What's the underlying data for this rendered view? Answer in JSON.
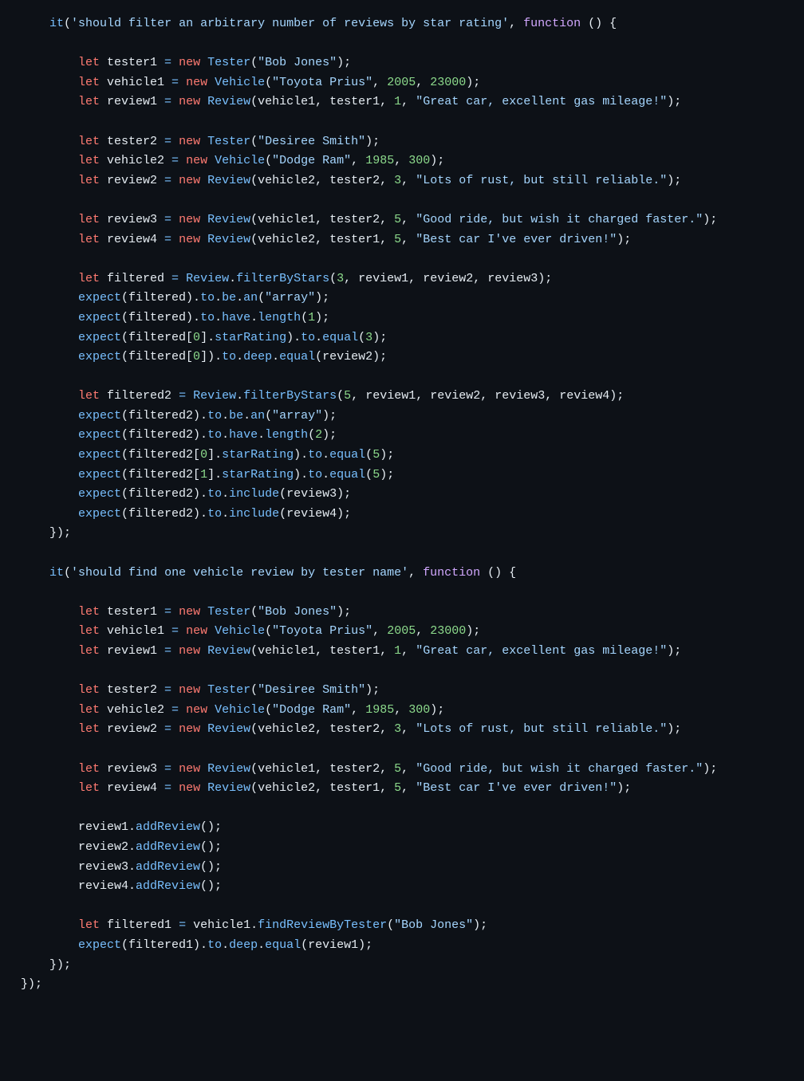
{
  "tokens": [
    [
      [
        "    ",
        "pu"
      ],
      [
        "it",
        "fn"
      ],
      [
        "(",
        "pu"
      ],
      [
        "'should filter an arbitrary number of reviews by star rating'",
        "st"
      ],
      [
        ", ",
        "pu"
      ],
      [
        "function",
        "fk"
      ],
      [
        " () {",
        "pu"
      ]
    ],
    [],
    [
      [
        "        ",
        "pu"
      ],
      [
        "let",
        "kw"
      ],
      [
        " tester1 ",
        "id"
      ],
      [
        "=",
        "op"
      ],
      [
        " ",
        "pu"
      ],
      [
        "new",
        "kw"
      ],
      [
        " ",
        "pu"
      ],
      [
        "Tester",
        "fn"
      ],
      [
        "(",
        "pu"
      ],
      [
        "\"Bob Jones\"",
        "st"
      ],
      [
        ");",
        "pu"
      ]
    ],
    [
      [
        "        ",
        "pu"
      ],
      [
        "let",
        "kw"
      ],
      [
        " vehicle1 ",
        "id"
      ],
      [
        "=",
        "op"
      ],
      [
        " ",
        "pu"
      ],
      [
        "new",
        "kw"
      ],
      [
        " ",
        "pu"
      ],
      [
        "Vehicle",
        "fn"
      ],
      [
        "(",
        "pu"
      ],
      [
        "\"Toyota Prius\"",
        "st"
      ],
      [
        ", ",
        "pu"
      ],
      [
        "2005",
        "nu"
      ],
      [
        ", ",
        "pu"
      ],
      [
        "23000",
        "nu"
      ],
      [
        ");",
        "pu"
      ]
    ],
    [
      [
        "        ",
        "pu"
      ],
      [
        "let",
        "kw"
      ],
      [
        " review1 ",
        "id"
      ],
      [
        "=",
        "op"
      ],
      [
        " ",
        "pu"
      ],
      [
        "new",
        "kw"
      ],
      [
        " ",
        "pu"
      ],
      [
        "Review",
        "fn"
      ],
      [
        "(vehicle1, tester1, ",
        "pu"
      ],
      [
        "1",
        "nu"
      ],
      [
        ", ",
        "pu"
      ],
      [
        "\"Great car, excellent gas mileage!\"",
        "st"
      ],
      [
        ");",
        "pu"
      ]
    ],
    [],
    [
      [
        "        ",
        "pu"
      ],
      [
        "let",
        "kw"
      ],
      [
        " tester2 ",
        "id"
      ],
      [
        "=",
        "op"
      ],
      [
        " ",
        "pu"
      ],
      [
        "new",
        "kw"
      ],
      [
        " ",
        "pu"
      ],
      [
        "Tester",
        "fn"
      ],
      [
        "(",
        "pu"
      ],
      [
        "\"Desiree Smith\"",
        "st"
      ],
      [
        ");",
        "pu"
      ]
    ],
    [
      [
        "        ",
        "pu"
      ],
      [
        "let",
        "kw"
      ],
      [
        " vehicle2 ",
        "id"
      ],
      [
        "=",
        "op"
      ],
      [
        " ",
        "pu"
      ],
      [
        "new",
        "kw"
      ],
      [
        " ",
        "pu"
      ],
      [
        "Vehicle",
        "fn"
      ],
      [
        "(",
        "pu"
      ],
      [
        "\"Dodge Ram\"",
        "st"
      ],
      [
        ", ",
        "pu"
      ],
      [
        "1985",
        "nu"
      ],
      [
        ", ",
        "pu"
      ],
      [
        "300",
        "nu"
      ],
      [
        ");",
        "pu"
      ]
    ],
    [
      [
        "        ",
        "pu"
      ],
      [
        "let",
        "kw"
      ],
      [
        " review2 ",
        "id"
      ],
      [
        "=",
        "op"
      ],
      [
        " ",
        "pu"
      ],
      [
        "new",
        "kw"
      ],
      [
        " ",
        "pu"
      ],
      [
        "Review",
        "fn"
      ],
      [
        "(vehicle2, tester2, ",
        "pu"
      ],
      [
        "3",
        "nu"
      ],
      [
        ", ",
        "pu"
      ],
      [
        "\"Lots of rust, but still reliable.\"",
        "st"
      ],
      [
        ");",
        "pu"
      ]
    ],
    [],
    [
      [
        "        ",
        "pu"
      ],
      [
        "let",
        "kw"
      ],
      [
        " review3 ",
        "id"
      ],
      [
        "=",
        "op"
      ],
      [
        " ",
        "pu"
      ],
      [
        "new",
        "kw"
      ],
      [
        " ",
        "pu"
      ],
      [
        "Review",
        "fn"
      ],
      [
        "(vehicle1, tester2, ",
        "pu"
      ],
      [
        "5",
        "nu"
      ],
      [
        ", ",
        "pu"
      ],
      [
        "\"Good ride, but wish it charged faster.\"",
        "st"
      ],
      [
        ");",
        "pu"
      ]
    ],
    [
      [
        "        ",
        "pu"
      ],
      [
        "let",
        "kw"
      ],
      [
        " review4 ",
        "id"
      ],
      [
        "=",
        "op"
      ],
      [
        " ",
        "pu"
      ],
      [
        "new",
        "kw"
      ],
      [
        " ",
        "pu"
      ],
      [
        "Review",
        "fn"
      ],
      [
        "(vehicle2, tester1, ",
        "pu"
      ],
      [
        "5",
        "nu"
      ],
      [
        ", ",
        "pu"
      ],
      [
        "\"Best car I've ever driven!\"",
        "st"
      ],
      [
        ");",
        "pu"
      ]
    ],
    [],
    [
      [
        "        ",
        "pu"
      ],
      [
        "let",
        "kw"
      ],
      [
        " filtered ",
        "id"
      ],
      [
        "=",
        "op"
      ],
      [
        " ",
        "pu"
      ],
      [
        "Review",
        "fn"
      ],
      [
        ".",
        "pu"
      ],
      [
        "filterByStars",
        "fn"
      ],
      [
        "(",
        "pu"
      ],
      [
        "3",
        "nu"
      ],
      [
        ", review1, review2, review3);",
        "pu"
      ]
    ],
    [
      [
        "        ",
        "pu"
      ],
      [
        "expect",
        "fn"
      ],
      [
        "(filtered).",
        "pu"
      ],
      [
        "to",
        "fn"
      ],
      [
        ".",
        "pu"
      ],
      [
        "be",
        "fn"
      ],
      [
        ".",
        "pu"
      ],
      [
        "an",
        "fn"
      ],
      [
        "(",
        "pu"
      ],
      [
        "\"array\"",
        "st"
      ],
      [
        ");",
        "pu"
      ]
    ],
    [
      [
        "        ",
        "pu"
      ],
      [
        "expect",
        "fn"
      ],
      [
        "(filtered).",
        "pu"
      ],
      [
        "to",
        "fn"
      ],
      [
        ".",
        "pu"
      ],
      [
        "have",
        "fn"
      ],
      [
        ".",
        "pu"
      ],
      [
        "length",
        "fn"
      ],
      [
        "(",
        "pu"
      ],
      [
        "1",
        "nu"
      ],
      [
        ");",
        "pu"
      ]
    ],
    [
      [
        "        ",
        "pu"
      ],
      [
        "expect",
        "fn"
      ],
      [
        "(filtered[",
        "pu"
      ],
      [
        "0",
        "nu"
      ],
      [
        "].",
        "pu"
      ],
      [
        "starRating",
        "fn"
      ],
      [
        ").",
        "pu"
      ],
      [
        "to",
        "fn"
      ],
      [
        ".",
        "pu"
      ],
      [
        "equal",
        "fn"
      ],
      [
        "(",
        "pu"
      ],
      [
        "3",
        "nu"
      ],
      [
        ");",
        "pu"
      ]
    ],
    [
      [
        "        ",
        "pu"
      ],
      [
        "expect",
        "fn"
      ],
      [
        "(filtered[",
        "pu"
      ],
      [
        "0",
        "nu"
      ],
      [
        "]).",
        "pu"
      ],
      [
        "to",
        "fn"
      ],
      [
        ".",
        "pu"
      ],
      [
        "deep",
        "fn"
      ],
      [
        ".",
        "pu"
      ],
      [
        "equal",
        "fn"
      ],
      [
        "(review2);",
        "pu"
      ]
    ],
    [],
    [
      [
        "        ",
        "pu"
      ],
      [
        "let",
        "kw"
      ],
      [
        " filtered2 ",
        "id"
      ],
      [
        "=",
        "op"
      ],
      [
        " ",
        "pu"
      ],
      [
        "Review",
        "fn"
      ],
      [
        ".",
        "pu"
      ],
      [
        "filterByStars",
        "fn"
      ],
      [
        "(",
        "pu"
      ],
      [
        "5",
        "nu"
      ],
      [
        ", review1, review2, review3, review4);",
        "pu"
      ]
    ],
    [
      [
        "        ",
        "pu"
      ],
      [
        "expect",
        "fn"
      ],
      [
        "(filtered2).",
        "pu"
      ],
      [
        "to",
        "fn"
      ],
      [
        ".",
        "pu"
      ],
      [
        "be",
        "fn"
      ],
      [
        ".",
        "pu"
      ],
      [
        "an",
        "fn"
      ],
      [
        "(",
        "pu"
      ],
      [
        "\"array\"",
        "st"
      ],
      [
        ");",
        "pu"
      ]
    ],
    [
      [
        "        ",
        "pu"
      ],
      [
        "expect",
        "fn"
      ],
      [
        "(filtered2).",
        "pu"
      ],
      [
        "to",
        "fn"
      ],
      [
        ".",
        "pu"
      ],
      [
        "have",
        "fn"
      ],
      [
        ".",
        "pu"
      ],
      [
        "length",
        "fn"
      ],
      [
        "(",
        "pu"
      ],
      [
        "2",
        "nu"
      ],
      [
        ");",
        "pu"
      ]
    ],
    [
      [
        "        ",
        "pu"
      ],
      [
        "expect",
        "fn"
      ],
      [
        "(filtered2[",
        "pu"
      ],
      [
        "0",
        "nu"
      ],
      [
        "].",
        "pu"
      ],
      [
        "starRating",
        "fn"
      ],
      [
        ").",
        "pu"
      ],
      [
        "to",
        "fn"
      ],
      [
        ".",
        "pu"
      ],
      [
        "equal",
        "fn"
      ],
      [
        "(",
        "pu"
      ],
      [
        "5",
        "nu"
      ],
      [
        ");",
        "pu"
      ]
    ],
    [
      [
        "        ",
        "pu"
      ],
      [
        "expect",
        "fn"
      ],
      [
        "(filtered2[",
        "pu"
      ],
      [
        "1",
        "nu"
      ],
      [
        "].",
        "pu"
      ],
      [
        "starRating",
        "fn"
      ],
      [
        ").",
        "pu"
      ],
      [
        "to",
        "fn"
      ],
      [
        ".",
        "pu"
      ],
      [
        "equal",
        "fn"
      ],
      [
        "(",
        "pu"
      ],
      [
        "5",
        "nu"
      ],
      [
        ");",
        "pu"
      ]
    ],
    [
      [
        "        ",
        "pu"
      ],
      [
        "expect",
        "fn"
      ],
      [
        "(filtered2).",
        "pu"
      ],
      [
        "to",
        "fn"
      ],
      [
        ".",
        "pu"
      ],
      [
        "include",
        "fn"
      ],
      [
        "(review3);",
        "pu"
      ]
    ],
    [
      [
        "        ",
        "pu"
      ],
      [
        "expect",
        "fn"
      ],
      [
        "(filtered2).",
        "pu"
      ],
      [
        "to",
        "fn"
      ],
      [
        ".",
        "pu"
      ],
      [
        "include",
        "fn"
      ],
      [
        "(review4);",
        "pu"
      ]
    ],
    [
      [
        "    });",
        "pu"
      ]
    ],
    [],
    [
      [
        "    ",
        "pu"
      ],
      [
        "it",
        "fn"
      ],
      [
        "(",
        "pu"
      ],
      [
        "'should find one vehicle review by tester name'",
        "st"
      ],
      [
        ", ",
        "pu"
      ],
      [
        "function",
        "fk"
      ],
      [
        " () {",
        "pu"
      ]
    ],
    [],
    [
      [
        "        ",
        "pu"
      ],
      [
        "let",
        "kw"
      ],
      [
        " tester1 ",
        "id"
      ],
      [
        "=",
        "op"
      ],
      [
        " ",
        "pu"
      ],
      [
        "new",
        "kw"
      ],
      [
        " ",
        "pu"
      ],
      [
        "Tester",
        "fn"
      ],
      [
        "(",
        "pu"
      ],
      [
        "\"Bob Jones\"",
        "st"
      ],
      [
        ");",
        "pu"
      ]
    ],
    [
      [
        "        ",
        "pu"
      ],
      [
        "let",
        "kw"
      ],
      [
        " vehicle1 ",
        "id"
      ],
      [
        "=",
        "op"
      ],
      [
        " ",
        "pu"
      ],
      [
        "new",
        "kw"
      ],
      [
        " ",
        "pu"
      ],
      [
        "Vehicle",
        "fn"
      ],
      [
        "(",
        "pu"
      ],
      [
        "\"Toyota Prius\"",
        "st"
      ],
      [
        ", ",
        "pu"
      ],
      [
        "2005",
        "nu"
      ],
      [
        ", ",
        "pu"
      ],
      [
        "23000",
        "nu"
      ],
      [
        ");",
        "pu"
      ]
    ],
    [
      [
        "        ",
        "pu"
      ],
      [
        "let",
        "kw"
      ],
      [
        " review1 ",
        "id"
      ],
      [
        "=",
        "op"
      ],
      [
        " ",
        "pu"
      ],
      [
        "new",
        "kw"
      ],
      [
        " ",
        "pu"
      ],
      [
        "Review",
        "fn"
      ],
      [
        "(vehicle1, tester1, ",
        "pu"
      ],
      [
        "1",
        "nu"
      ],
      [
        ", ",
        "pu"
      ],
      [
        "\"Great car, excellent gas mileage!\"",
        "st"
      ],
      [
        ");",
        "pu"
      ]
    ],
    [],
    [
      [
        "        ",
        "pu"
      ],
      [
        "let",
        "kw"
      ],
      [
        " tester2 ",
        "id"
      ],
      [
        "=",
        "op"
      ],
      [
        " ",
        "pu"
      ],
      [
        "new",
        "kw"
      ],
      [
        " ",
        "pu"
      ],
      [
        "Tester",
        "fn"
      ],
      [
        "(",
        "pu"
      ],
      [
        "\"Desiree Smith\"",
        "st"
      ],
      [
        ");",
        "pu"
      ]
    ],
    [
      [
        "        ",
        "pu"
      ],
      [
        "let",
        "kw"
      ],
      [
        " vehicle2 ",
        "id"
      ],
      [
        "=",
        "op"
      ],
      [
        " ",
        "pu"
      ],
      [
        "new",
        "kw"
      ],
      [
        " ",
        "pu"
      ],
      [
        "Vehicle",
        "fn"
      ],
      [
        "(",
        "pu"
      ],
      [
        "\"Dodge Ram\"",
        "st"
      ],
      [
        ", ",
        "pu"
      ],
      [
        "1985",
        "nu"
      ],
      [
        ", ",
        "pu"
      ],
      [
        "300",
        "nu"
      ],
      [
        ");",
        "pu"
      ]
    ],
    [
      [
        "        ",
        "pu"
      ],
      [
        "let",
        "kw"
      ],
      [
        " review2 ",
        "id"
      ],
      [
        "=",
        "op"
      ],
      [
        " ",
        "pu"
      ],
      [
        "new",
        "kw"
      ],
      [
        " ",
        "pu"
      ],
      [
        "Review",
        "fn"
      ],
      [
        "(vehicle2, tester2, ",
        "pu"
      ],
      [
        "3",
        "nu"
      ],
      [
        ", ",
        "pu"
      ],
      [
        "\"Lots of rust, but still reliable.\"",
        "st"
      ],
      [
        ");",
        "pu"
      ]
    ],
    [],
    [
      [
        "        ",
        "pu"
      ],
      [
        "let",
        "kw"
      ],
      [
        " review3 ",
        "id"
      ],
      [
        "=",
        "op"
      ],
      [
        " ",
        "pu"
      ],
      [
        "new",
        "kw"
      ],
      [
        " ",
        "pu"
      ],
      [
        "Review",
        "fn"
      ],
      [
        "(vehicle1, tester2, ",
        "pu"
      ],
      [
        "5",
        "nu"
      ],
      [
        ", ",
        "pu"
      ],
      [
        "\"Good ride, but wish it charged faster.\"",
        "st"
      ],
      [
        ");",
        "pu"
      ]
    ],
    [
      [
        "        ",
        "pu"
      ],
      [
        "let",
        "kw"
      ],
      [
        " review4 ",
        "id"
      ],
      [
        "=",
        "op"
      ],
      [
        " ",
        "pu"
      ],
      [
        "new",
        "kw"
      ],
      [
        " ",
        "pu"
      ],
      [
        "Review",
        "fn"
      ],
      [
        "(vehicle2, tester1, ",
        "pu"
      ],
      [
        "5",
        "nu"
      ],
      [
        ", ",
        "pu"
      ],
      [
        "\"Best car I've ever driven!\"",
        "st"
      ],
      [
        ");",
        "pu"
      ]
    ],
    [],
    [
      [
        "        review1.",
        "pu"
      ],
      [
        "addReview",
        "fn"
      ],
      [
        "();",
        "pu"
      ]
    ],
    [
      [
        "        review2.",
        "pu"
      ],
      [
        "addReview",
        "fn"
      ],
      [
        "();",
        "pu"
      ]
    ],
    [
      [
        "        review3.",
        "pu"
      ],
      [
        "addReview",
        "fn"
      ],
      [
        "();",
        "pu"
      ]
    ],
    [
      [
        "        review4.",
        "pu"
      ],
      [
        "addReview",
        "fn"
      ],
      [
        "();",
        "pu"
      ]
    ],
    [],
    [
      [
        "        ",
        "pu"
      ],
      [
        "let",
        "kw"
      ],
      [
        " filtered1 ",
        "id"
      ],
      [
        "=",
        "op"
      ],
      [
        " vehicle1.",
        "pu"
      ],
      [
        "findReviewByTester",
        "fn"
      ],
      [
        "(",
        "pu"
      ],
      [
        "\"Bob Jones\"",
        "st"
      ],
      [
        ");",
        "pu"
      ]
    ],
    [
      [
        "        ",
        "pu"
      ],
      [
        "expect",
        "fn"
      ],
      [
        "(filtered1).",
        "pu"
      ],
      [
        "to",
        "fn"
      ],
      [
        ".",
        "pu"
      ],
      [
        "deep",
        "fn"
      ],
      [
        ".",
        "pu"
      ],
      [
        "equal",
        "fn"
      ],
      [
        "(review1);",
        "pu"
      ]
    ],
    [
      [
        "    });",
        "pu"
      ]
    ],
    [
      [
        "});",
        "pu"
      ]
    ]
  ]
}
